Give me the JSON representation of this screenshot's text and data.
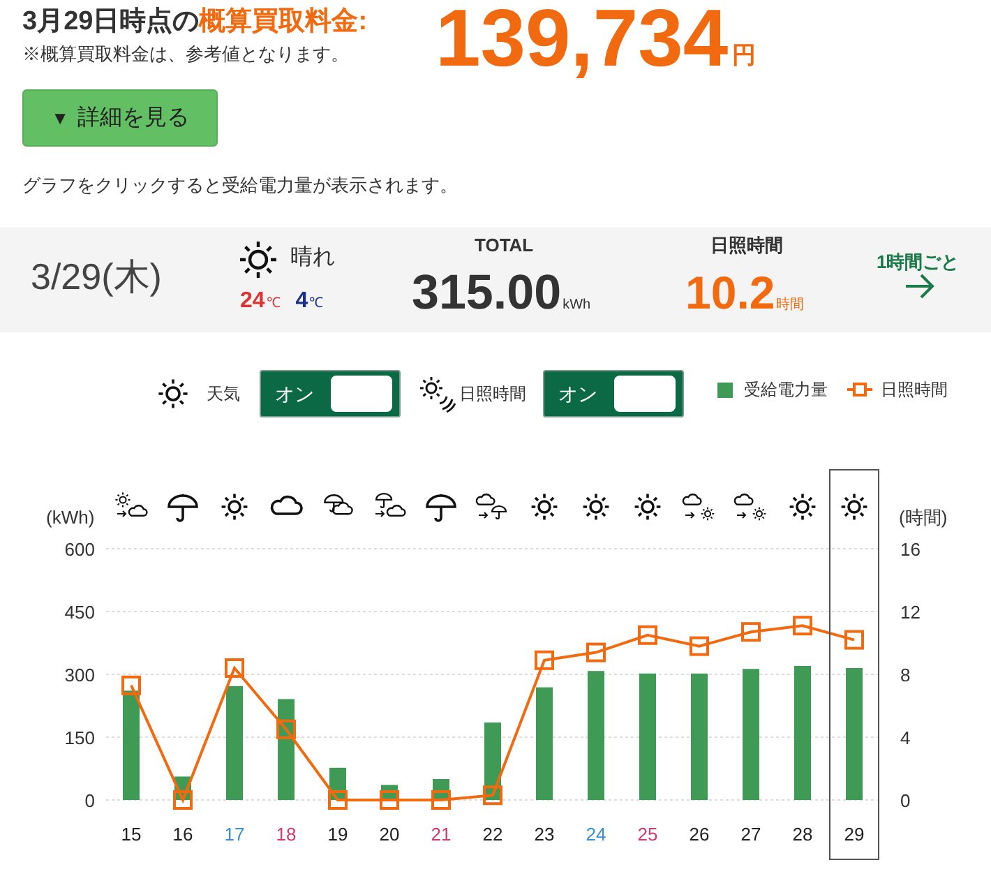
{
  "header": {
    "title_prefix": "3月29日時点の",
    "title_highlight": "概算買取料金:",
    "note": "※概算買取料金は、参考値となります。",
    "amount": "139,734",
    "amount_unit": "円"
  },
  "details_button": {
    "icon": "▼",
    "label": "詳細を見る"
  },
  "hint": "グラフをクリックすると受給電力量が表示されます。",
  "summary": {
    "date": "3/29(木)",
    "weather": "晴れ",
    "high": "24",
    "high_unit": "℃",
    "low": "4",
    "low_unit": "℃",
    "total_label": "TOTAL",
    "total": "315.00",
    "total_unit": "kWh",
    "sun_label": "日照時間",
    "sun_hours": "10.2",
    "sun_unit": "時間",
    "hourly_link": "1時間ごと"
  },
  "toggles": [
    {
      "kind": "weather",
      "label": "天気",
      "state_label": "オン",
      "on": true
    },
    {
      "kind": "sunshine",
      "label": "日照時間",
      "state_label": "オン",
      "on": true
    }
  ],
  "days": [
    {
      "kind": "sun_then_cloud",
      "color": "#222222",
      "selected": false
    },
    {
      "kind": "rain",
      "color": "#222222",
      "selected": false
    },
    {
      "kind": "sun",
      "color": "#3a8fd0",
      "selected": false
    },
    {
      "kind": "cloud",
      "color": "#d03a6e",
      "selected": false
    },
    {
      "kind": "rain_cloud",
      "color": "#222222",
      "selected": false
    },
    {
      "kind": "rain_then_cloud",
      "color": "#222222",
      "selected": false
    },
    {
      "kind": "rain",
      "color": "#d03a6e",
      "selected": false
    },
    {
      "kind": "cloud_then_rain",
      "color": "#222222",
      "selected": false
    },
    {
      "kind": "sun",
      "color": "#222222",
      "selected": false
    },
    {
      "kind": "sun",
      "color": "#3a8fd0",
      "selected": false
    },
    {
      "kind": "sun",
      "color": "#d03a6e",
      "selected": false
    },
    {
      "kind": "cloud_then_sun",
      "color": "#222222",
      "selected": false
    },
    {
      "kind": "cloud_then_sun",
      "color": "#222222",
      "selected": false
    },
    {
      "kind": "sun",
      "color": "#222222",
      "selected": false
    },
    {
      "kind": "sun",
      "color": "#222222",
      "selected": true
    }
  ],
  "chart_data": {
    "type": "bar",
    "ylabel": "(kWh)",
    "y2label": "(時間)",
    "categories": [
      "15",
      "16",
      "17",
      "18",
      "19",
      "20",
      "21",
      "22",
      "23",
      "24",
      "25",
      "26",
      "27",
      "28",
      "29"
    ],
    "series": [
      {
        "name": "受給電力量",
        "color": "#3f9a55",
        "type": "bar",
        "values": [
          261,
          56,
          272,
          241,
          77,
          36,
          50,
          185,
          269,
          308,
          302,
          302,
          313,
          320,
          315
        ]
      },
      {
        "name": "日照時間",
        "color": "#f26a10",
        "type": "line",
        "axis": "y2",
        "marker": "square",
        "values": [
          7.3,
          0,
          8.4,
          4.5,
          0,
          0,
          0,
          0.3,
          8.9,
          9.4,
          10.5,
          9.8,
          10.7,
          11.1,
          10.2
        ]
      }
    ],
    "grid": true,
    "ylim": [
      0,
      600
    ],
    "yticks": [
      0,
      150,
      300,
      450,
      600
    ],
    "y2lim": [
      0,
      16
    ],
    "y2ticks": [
      0,
      4,
      8,
      12,
      16
    ]
  }
}
